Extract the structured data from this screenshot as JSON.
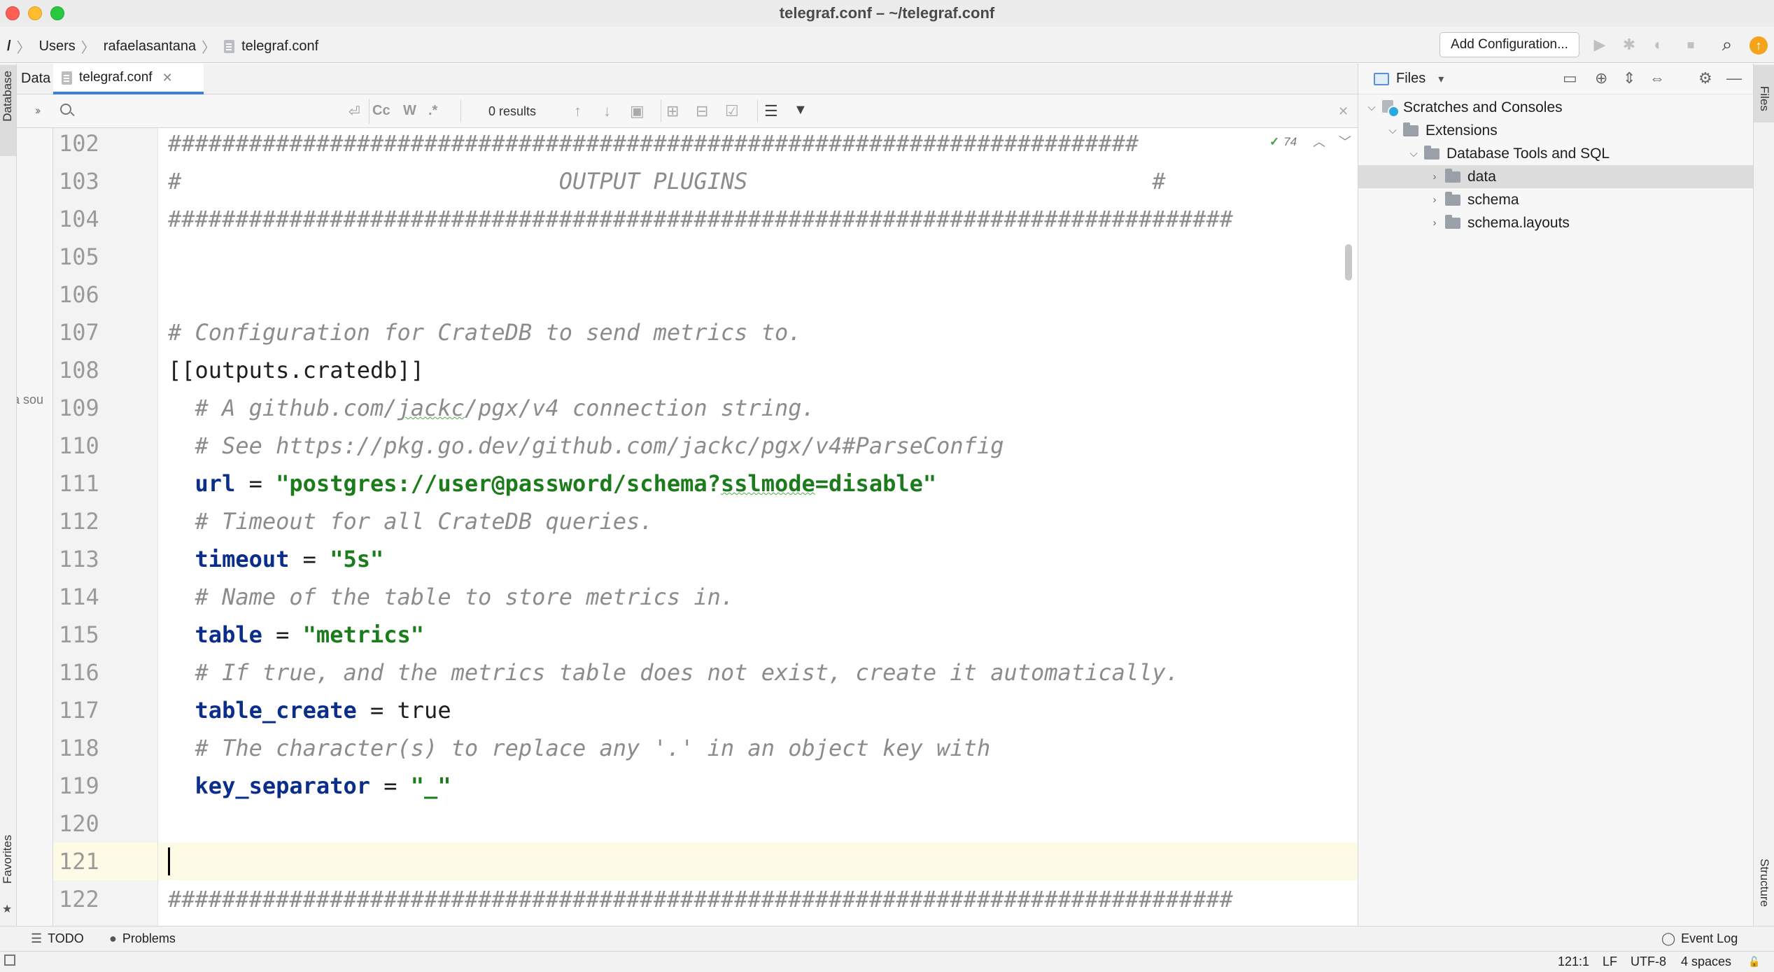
{
  "window": {
    "title": "telegraf.conf – ~/telegraf.conf"
  },
  "breadcrumbs": [
    "/",
    "Users",
    "rafaelasantana",
    "telegraf.conf"
  ],
  "toolbar": {
    "add_configuration_label": "Add Configuration...",
    "run_icon": "▶",
    "debug_icon": "✱",
    "coverage_icon": "◐",
    "stop_icon": "■",
    "search_icon": "⌕",
    "update_icon": "↑"
  },
  "left_tools": {
    "database_tab": "Database",
    "favorites_tab": "Favorites",
    "db_panel_partial_text": "a sou"
  },
  "editor_tabs": {
    "data_tab": "Data",
    "active_tab": "telegraf.conf",
    "close_glyph": "✕"
  },
  "search": {
    "query": "",
    "placeholder": "",
    "chevrons": "››",
    "case_option": "Cc",
    "words_option": "W",
    "regex_option": ".*",
    "results": "0 results",
    "enter_glyph": "⏎",
    "prev_glyph": "↑",
    "next_glyph": "↓",
    "select_all_glyph": "▣",
    "add_glyph": "⊞",
    "remove_glyph": "⊟",
    "check_glyph": "☑",
    "multiline_glyph": "☰",
    "filter_glyph": "▼",
    "close_glyph": "✕"
  },
  "inspection": {
    "check_glyph": "✓",
    "count": "74",
    "up_glyph": "︿",
    "down_glyph": "﹀"
  },
  "editor": {
    "current_line": "121",
    "lines": [
      {
        "num": "102",
        "parts": [
          {
            "t": "########################################################################",
            "c": "comment"
          }
        ]
      },
      {
        "num": "103",
        "parts": [
          {
            "t": "#                            OUTPUT PLUGINS                              #",
            "c": "comment"
          }
        ]
      },
      {
        "num": "104",
        "parts": [
          {
            "t": "###############################################################################",
            "c": "comment"
          }
        ]
      },
      {
        "num": "105",
        "parts": []
      },
      {
        "num": "106",
        "parts": []
      },
      {
        "num": "107",
        "parts": [
          {
            "t": "# Configuration for CrateDB to send metrics to.",
            "c": "comment"
          }
        ]
      },
      {
        "num": "108",
        "parts": [
          {
            "t": "[[outputs.cratedb]]",
            "c": "plain"
          }
        ]
      },
      {
        "num": "109",
        "parts": [
          {
            "t": "  # A github.com/",
            "c": "comment"
          },
          {
            "t": "jackc",
            "c": "comment squig"
          },
          {
            "t": "/pgx/v4 connection string.",
            "c": "comment"
          }
        ]
      },
      {
        "num": "110",
        "parts": [
          {
            "t": "  # See https://pkg.go.dev/github.com/jackc/pgx/v4#ParseConfig",
            "c": "comment"
          }
        ]
      },
      {
        "num": "111",
        "parts": [
          {
            "t": "  url",
            "c": "key"
          },
          {
            "t": " = ",
            "c": "plain"
          },
          {
            "t": "\"postgres://user@password/schema?",
            "c": "str"
          },
          {
            "t": "sslmode",
            "c": "str squig"
          },
          {
            "t": "=disable\"",
            "c": "str"
          }
        ]
      },
      {
        "num": "112",
        "parts": [
          {
            "t": "  # Timeout for all CrateDB queries.",
            "c": "comment"
          }
        ]
      },
      {
        "num": "113",
        "parts": [
          {
            "t": "  timeout",
            "c": "key"
          },
          {
            "t": " = ",
            "c": "plain"
          },
          {
            "t": "\"5s\"",
            "c": "str"
          }
        ]
      },
      {
        "num": "114",
        "parts": [
          {
            "t": "  # Name of the table to store metrics in.",
            "c": "comment"
          }
        ]
      },
      {
        "num": "115",
        "parts": [
          {
            "t": "  table",
            "c": "key"
          },
          {
            "t": " = ",
            "c": "plain"
          },
          {
            "t": "\"metrics\"",
            "c": "str"
          }
        ]
      },
      {
        "num": "116",
        "parts": [
          {
            "t": "  # If true, and the metrics table does not exist, create it automatically.",
            "c": "comment"
          }
        ]
      },
      {
        "num": "117",
        "parts": [
          {
            "t": "  table_create",
            "c": "key"
          },
          {
            "t": " = true",
            "c": "plain"
          }
        ]
      },
      {
        "num": "118",
        "parts": [
          {
            "t": "  # The character(s) to replace any '.' in an object key with",
            "c": "comment"
          }
        ]
      },
      {
        "num": "119",
        "parts": [
          {
            "t": "  key_separator",
            "c": "key"
          },
          {
            "t": " = ",
            "c": "plain"
          },
          {
            "t": "\"_\"",
            "c": "str"
          }
        ]
      },
      {
        "num": "120",
        "parts": []
      },
      {
        "num": "121",
        "parts": []
      },
      {
        "num": "122",
        "parts": [
          {
            "t": "###############################################################################",
            "c": "comment"
          }
        ]
      }
    ]
  },
  "project_panel": {
    "title": "Files",
    "dropdown_glyph": "▾",
    "header_icons": [
      "▭",
      "⊕",
      "⇕",
      "⇔",
      "⚙",
      "—"
    ],
    "tree": [
      {
        "label": "Scratches and Consoles",
        "depth": 0,
        "expanded": true,
        "icon": "scratch",
        "selected": false
      },
      {
        "label": "Extensions",
        "depth": 1,
        "expanded": true,
        "icon": "folder",
        "selected": false
      },
      {
        "label": "Database Tools and SQL",
        "depth": 2,
        "expanded": true,
        "icon": "folder",
        "selected": false
      },
      {
        "label": "data",
        "depth": 3,
        "expanded": false,
        "icon": "folder",
        "selected": true
      },
      {
        "label": "schema",
        "depth": 3,
        "expanded": false,
        "icon": "folder",
        "selected": false
      },
      {
        "label": "schema.layouts",
        "depth": 3,
        "expanded": false,
        "icon": "folder",
        "selected": false
      }
    ]
  },
  "right_tools": {
    "files_tab": "Files",
    "structure_tab": "Structure"
  },
  "bottom_tools": {
    "todo": "TODO",
    "problems": "Problems",
    "event_log": "Event Log",
    "todo_glyph": "☰",
    "problems_glyph": "●",
    "event_glyph": "◯"
  },
  "status": {
    "position": "121:1",
    "line_ending": "LF",
    "encoding": "UTF-8",
    "indent": "4 spaces",
    "lock_glyph": "🔓"
  }
}
